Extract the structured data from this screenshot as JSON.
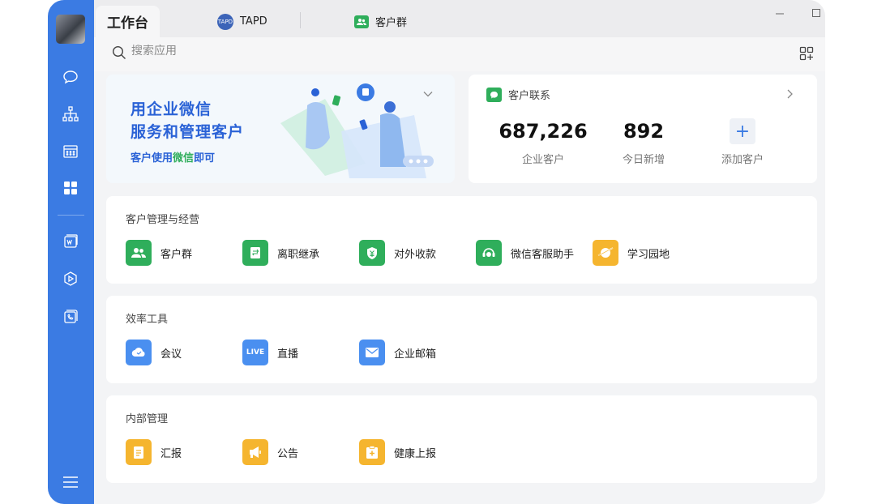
{
  "tabs": [
    {
      "label": "工作台"
    },
    {
      "label": "TAPD",
      "logo_text": "TAPD"
    },
    {
      "label": "客户群"
    }
  ],
  "search": {
    "placeholder": "搜索应用"
  },
  "banner": {
    "line1": "用企业微信",
    "line2": "服务和管理客户",
    "line3_prefix": "客户使用",
    "line3_highlight": "微信",
    "line3_suffix": "即可"
  },
  "customer_card": {
    "title": "客户联系",
    "stats": [
      {
        "value": "687,226",
        "label": "企业客户"
      },
      {
        "value": "892",
        "label": "今日新增"
      },
      {
        "value": "+",
        "label": "添加客户"
      }
    ]
  },
  "sections": [
    {
      "title": "客户管理与经营",
      "apps": [
        {
          "label": "客户群",
          "icon": "customer-group-icon",
          "color": "#2fae5b"
        },
        {
          "label": "离职继承",
          "icon": "resign-inherit-icon",
          "color": "#2fae5b"
        },
        {
          "label": "对外收款",
          "icon": "payment-icon",
          "color": "#2fae5b"
        },
        {
          "label": "微信客服助手",
          "icon": "wechat-service-icon",
          "color": "#2fae5b"
        },
        {
          "label": "学习园地",
          "icon": "learning-icon",
          "color": "#f5b52f"
        }
      ]
    },
    {
      "title": "效率工具",
      "apps": [
        {
          "label": "会议",
          "icon": "meeting-icon",
          "color": "#4a8ff0"
        },
        {
          "label": "直播",
          "icon": "live-icon",
          "color": "#4a8ff0",
          "icon_text": "LIVE"
        },
        {
          "label": "企业邮箱",
          "icon": "mail-icon",
          "color": "#4a8ff0"
        }
      ]
    },
    {
      "title": "内部管理",
      "apps": [
        {
          "label": "汇报",
          "icon": "report-icon",
          "color": "#f5b52f"
        },
        {
          "label": "公告",
          "icon": "announcement-icon",
          "color": "#f5b52f"
        },
        {
          "label": "健康上报",
          "icon": "health-report-icon",
          "color": "#f5b52f"
        }
      ]
    }
  ],
  "colors": {
    "rail": "#3b7be3",
    "accent_blue": "#2a62d6",
    "green": "#2fae5b",
    "yellow": "#f5b52f"
  }
}
